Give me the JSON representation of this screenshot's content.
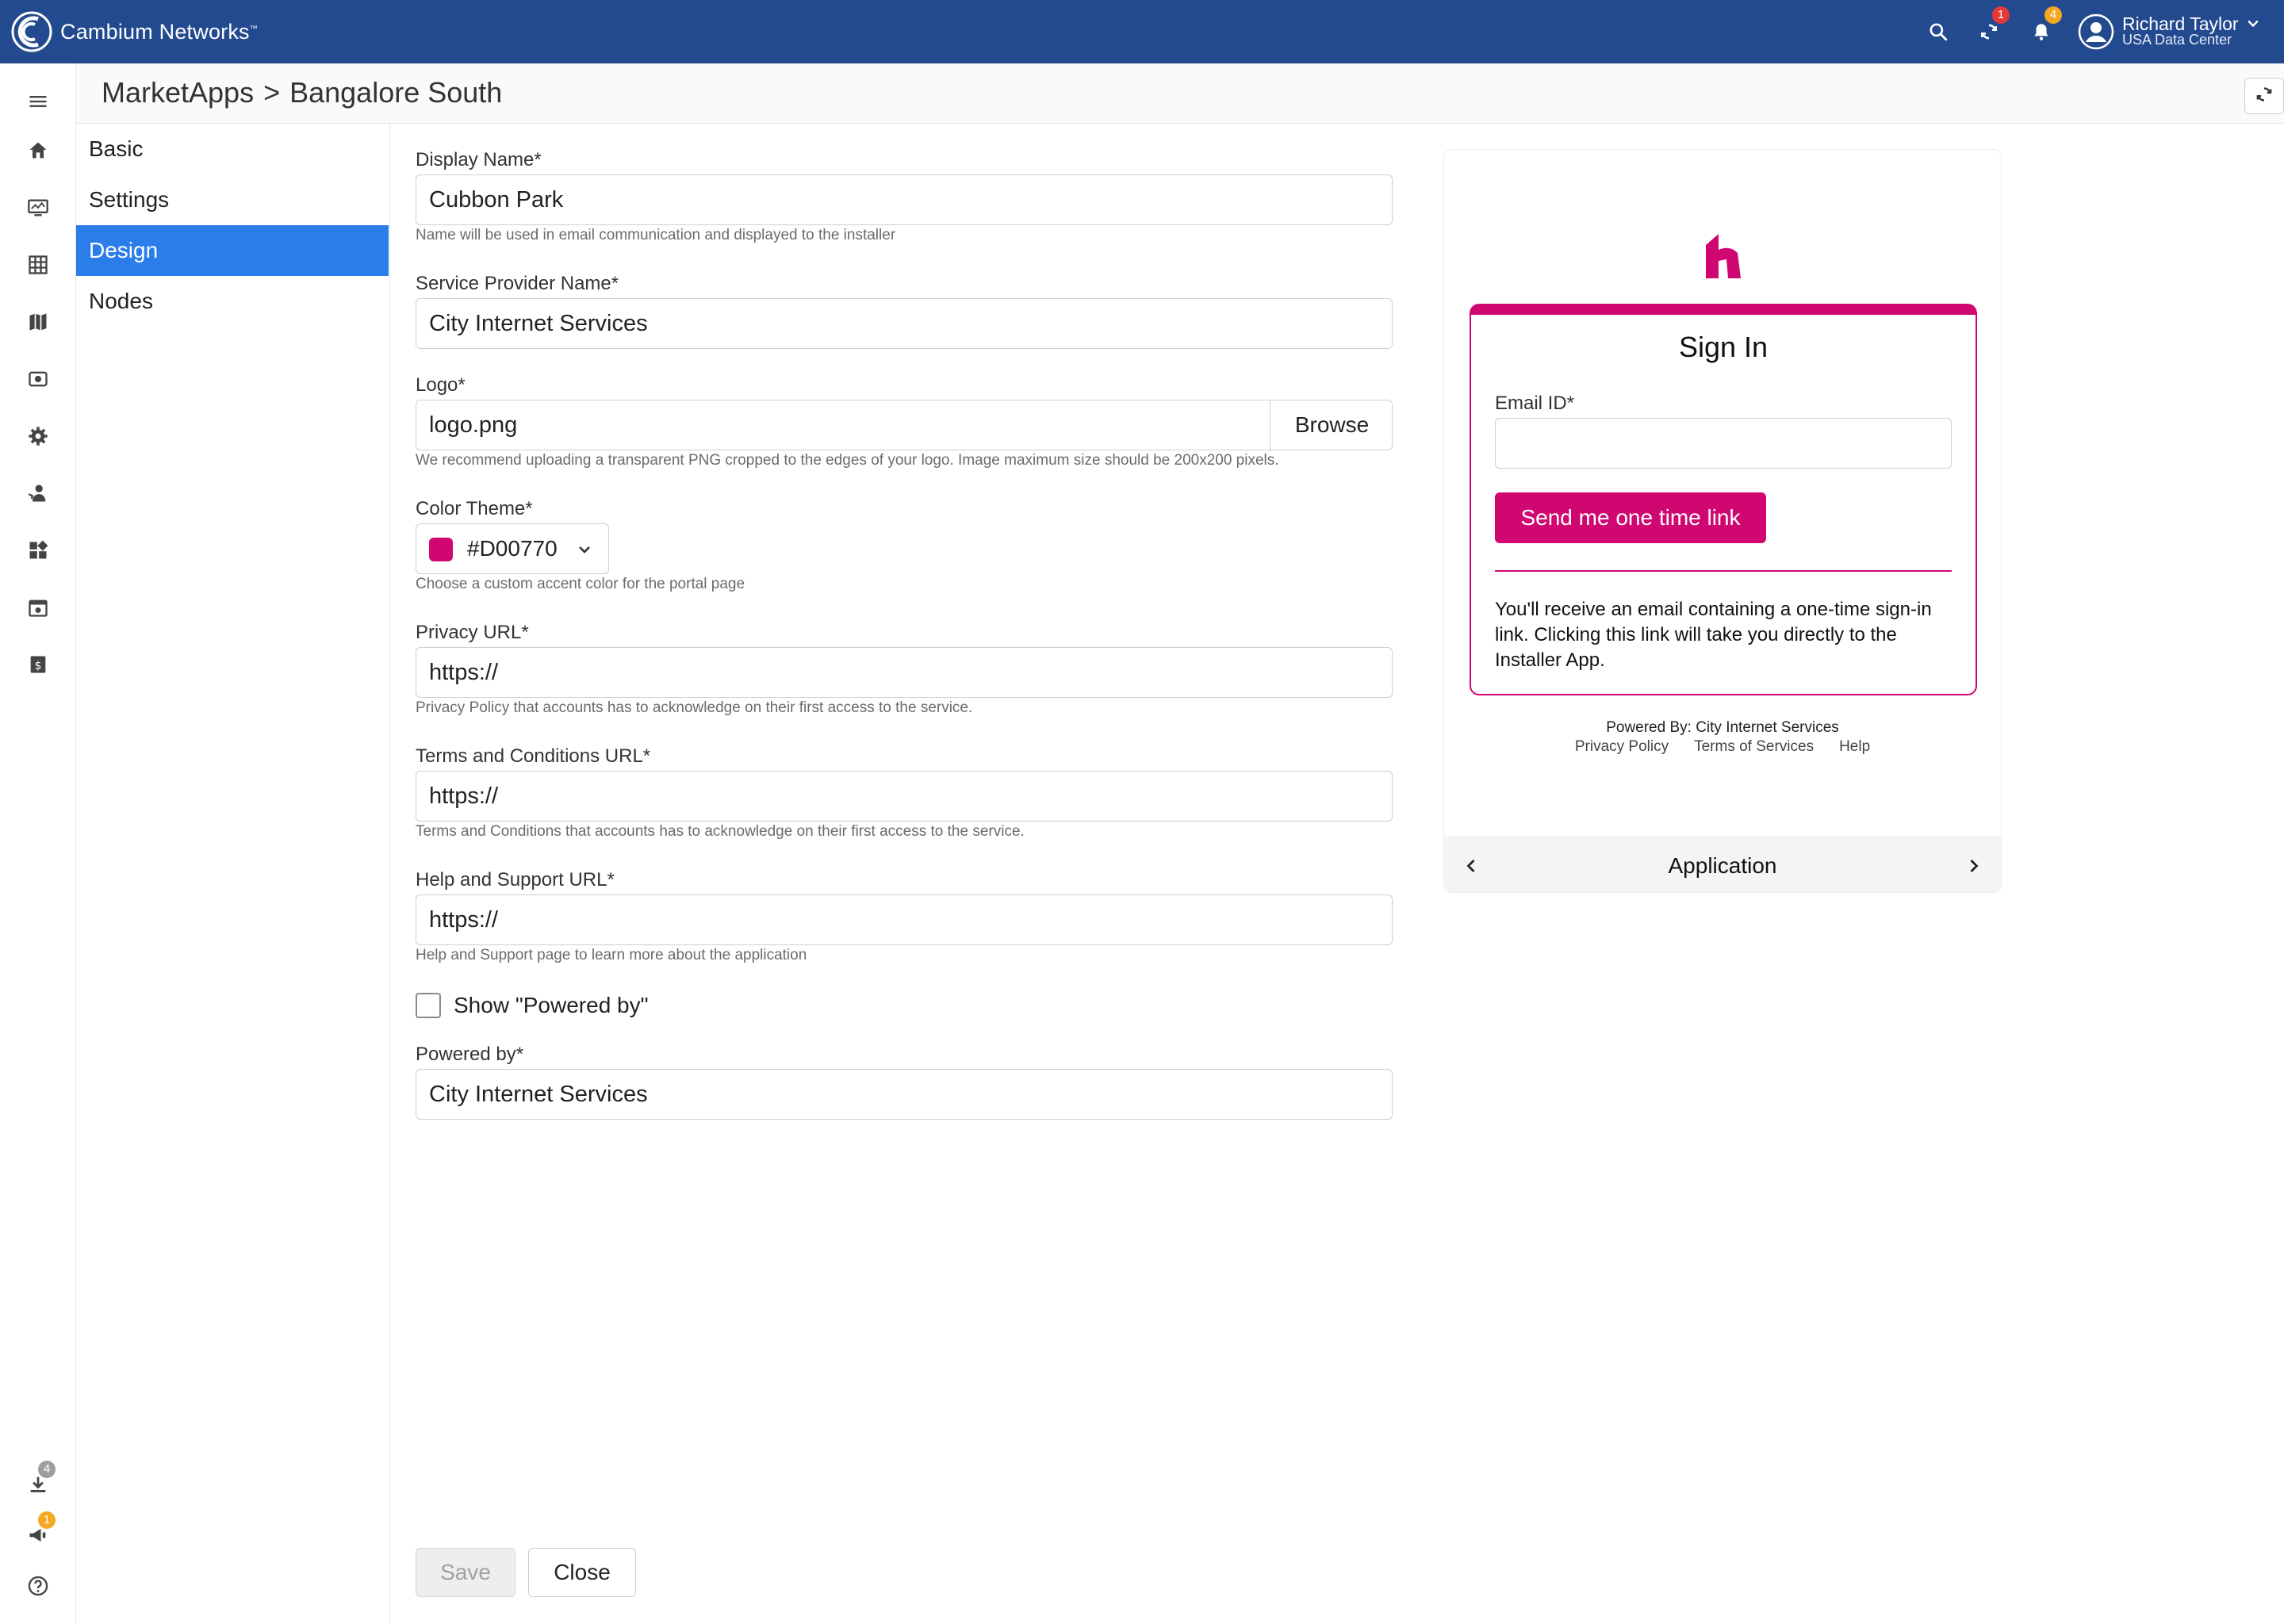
{
  "app": {
    "brand": "Cambium Networks",
    "brand_tm": "™"
  },
  "topbar": {
    "sync_badge": "1",
    "notifications_badge": "4",
    "user_name": "Richard Taylor",
    "user_center": "USA Data Center",
    "icons": [
      "search-icon",
      "sync-icon",
      "bell-icon",
      "account-icon",
      "chevron-down-icon"
    ]
  },
  "breadcrumb": {
    "parent": "MarketApps",
    "separator": ">",
    "current": "Bangalore South"
  },
  "rail": {
    "icons": [
      "menu-icon",
      "home-icon",
      "monitor-icon",
      "table-icon",
      "map-icon",
      "onboard-icon",
      "settings-icon",
      "users-icon",
      "apps-icon",
      "calendar-icon",
      "billing-icon",
      "download-icon",
      "announcement-icon",
      "help-icon"
    ],
    "downloads_badge": "4",
    "announcements_badge": "1"
  },
  "subnav": {
    "items": [
      {
        "label": "Basic"
      },
      {
        "label": "Settings"
      },
      {
        "label": "Design"
      },
      {
        "label": "Nodes"
      }
    ],
    "active": "Design"
  },
  "form": {
    "display_name": {
      "label": "Display Name",
      "required": "*",
      "value": "Cubbon Park",
      "hint": "Name will be used in email communication and displayed to the installer"
    },
    "service_provider": {
      "label": "Service Provider Name",
      "required": "*",
      "value": "City Internet Services"
    },
    "logo": {
      "label": "Logo",
      "required": "*",
      "value": "logo.png",
      "browse": "Browse",
      "hint": "We recommend uploading a transparent PNG cropped to the edges of your logo. Image maximum size should be 200x200 pixels."
    },
    "color_theme": {
      "label": "Color Theme",
      "required": "*",
      "value": "#D00770",
      "hint": "Choose a custom accent color for the portal page"
    },
    "privacy_url": {
      "label": "Privacy URL",
      "required": "*",
      "value": "https://",
      "hint": "Privacy Policy that accounts has to acknowledge on their first access to the service."
    },
    "terms_url": {
      "label": "Terms and Conditions URL",
      "required": "*",
      "value": "https://",
      "hint": "Terms and Conditions that accounts has to acknowledge on their first access to the service."
    },
    "help_url": {
      "label": "Help and Support URL",
      "required": "*",
      "value": "https://",
      "hint": "Help and Support page to learn more about the application"
    },
    "show_powered_by": {
      "label": "Show \"Powered by\"",
      "checked": false
    },
    "powered_by": {
      "label": "Powered by",
      "required": "*",
      "value": "City Internet Services"
    }
  },
  "actions": {
    "save": "Save",
    "close": "Close"
  },
  "preview": {
    "title": "Sign In",
    "email_label": "Email ID",
    "email_required": "*",
    "send_button": "Send me one time link",
    "message": "You'll receive an email containing a one-time sign-in link. Clicking this link will take you directly to the Installer App.",
    "powered_by": "Powered By: City Internet Services",
    "links": [
      "Privacy Policy",
      "Terms of Services",
      "Help"
    ],
    "footer_title": "Application"
  },
  "colors": {
    "topbar": "#234a8f",
    "accent": "#D00770",
    "active_nav": "#2b7de9"
  }
}
